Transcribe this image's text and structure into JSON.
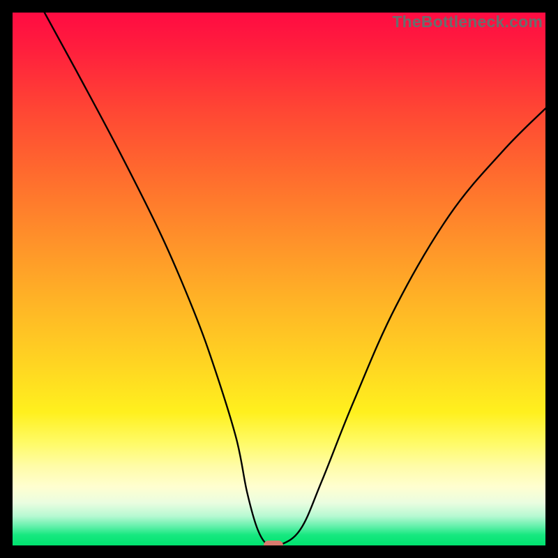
{
  "watermark": "TheBottleneck.com",
  "colors": {
    "frame": "#000000",
    "gradient_top": "#ff0b42",
    "gradient_mid": "#fff01e",
    "gradient_bottom": "#00e36f",
    "curve": "#000000",
    "marker": "#d97b6f",
    "watermark_text": "#6c6c6c"
  },
  "chart_data": {
    "type": "line",
    "title": "",
    "xlabel": "",
    "ylabel": "",
    "xlim": [
      0,
      100
    ],
    "ylim": [
      0,
      100
    ],
    "series": [
      {
        "name": "bottleneck-curve",
        "x": [
          6,
          12,
          20,
          28,
          34,
          38,
          42,
          44,
          46,
          48,
          50,
          54,
          58,
          64,
          72,
          82,
          92,
          100
        ],
        "values": [
          100,
          89,
          74,
          58,
          44,
          33,
          20,
          10,
          3,
          0,
          0,
          3,
          12,
          27,
          45,
          62,
          74,
          82
        ]
      }
    ],
    "marker": {
      "x": 49,
      "y": 0
    },
    "annotations": [
      {
        "text": "TheBottleneck.com",
        "position": "top-right"
      }
    ]
  }
}
